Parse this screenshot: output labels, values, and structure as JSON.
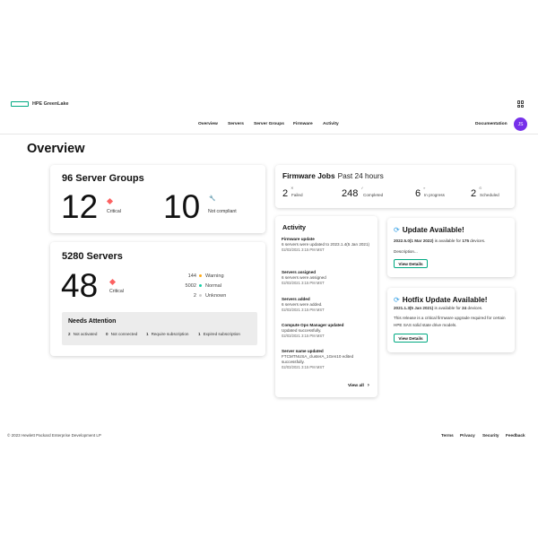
{
  "brand": {
    "name": "HPE GreenLake",
    "accent_color": "#01a982",
    "apps_icon": "apps-grid-icon"
  },
  "nav": {
    "items": [
      {
        "label": "Overview"
      },
      {
        "label": "Servers"
      },
      {
        "label": "Server Groups"
      },
      {
        "label": "Firmware"
      },
      {
        "label": "Activity"
      }
    ],
    "documentation": "Documentation",
    "avatar_initials": "JS",
    "avatar_color": "#7630ea"
  },
  "page": {
    "title": "Overview"
  },
  "server_groups": {
    "title": "96 Server Groups",
    "critical_count": "12",
    "critical_label": "Critical",
    "noncompliant_count": "10",
    "noncompliant_label": "Not compliant"
  },
  "servers": {
    "title": "5280 Servers",
    "critical_count": "48",
    "critical_label": "Critical",
    "statuses": [
      {
        "count": "144",
        "label": "Warning",
        "color": "#ffaa15"
      },
      {
        "count": "5002",
        "label": "Normal",
        "color": "#17d0a6"
      },
      {
        "count": "2",
        "label": "Unknown",
        "color": "#cccccc"
      }
    ],
    "needs_attention": {
      "title": "Needs Attention",
      "items": [
        {
          "count": "2",
          "label": "Not activated"
        },
        {
          "count": "0",
          "label": "Not connected"
        },
        {
          "count": "1",
          "label": "Require subscription"
        },
        {
          "count": "1",
          "label": "Expired subscription"
        }
      ]
    }
  },
  "firmware_jobs": {
    "title": "Firmware Jobs",
    "period": "Past 24 hours",
    "jobs": [
      {
        "count": "2",
        "label": "Failed",
        "icon": "failed-icon"
      },
      {
        "count": "248",
        "label": "Completed",
        "icon": "completed-icon"
      },
      {
        "count": "6",
        "label": "In progress",
        "icon": "in-progress-icon"
      },
      {
        "count": "2",
        "label": "Scheduled",
        "icon": "scheduled-icon"
      }
    ]
  },
  "activity": {
    "title": "Activity",
    "items": [
      {
        "title": "Firmware update",
        "desc": "6 servers were updated to 2023.1.4(5 Jan 2021)",
        "time": "02/03/2021 3:15 PM MST"
      },
      {
        "title": "Servers assigned",
        "desc": "6 servers were assigned",
        "time": "02/03/2021 3:15 PM MST"
      },
      {
        "title": "Servers added",
        "desc": "6 servers were added.",
        "time": "02/03/2021 3:15 PM MST"
      },
      {
        "title": "Compute Ops Manager updated",
        "desc": "Updated successfully.",
        "time": "02/03/2021 3:15 PM MST"
      },
      {
        "title": "Server name updated",
        "desc": "FTCMTNUSA_clusterA_1Gen10 edited successfully.",
        "time": "02/03/2021 3:15 PM MST"
      }
    ],
    "view_all": "View all"
  },
  "updates": [
    {
      "title": "Update Available!",
      "version": "2022.5.0(1 Mar 2022)",
      "text_before_count": " is available for ",
      "count": "175",
      "text_after_count": " devices.",
      "extra": "Description...",
      "button": "View Details"
    },
    {
      "title": "Hotfix Update Available!",
      "version": "2021.1.3(5 Jan 2021)",
      "text_before_count": " is available for ",
      "count": "24",
      "text_after_count": " devices.",
      "extra": "This release is a critical firmware upgrade required for certain HPE SAS solid state drive models.",
      "button": "View Details"
    }
  ],
  "footer": {
    "copyright": "© 2023 Hewlett Packard Enterprise Development LP",
    "links": [
      "Terms",
      "Privacy",
      "Security",
      "Feedback"
    ]
  },
  "colors": {
    "critical": "#fc6161",
    "info": "#2d9ce4"
  }
}
